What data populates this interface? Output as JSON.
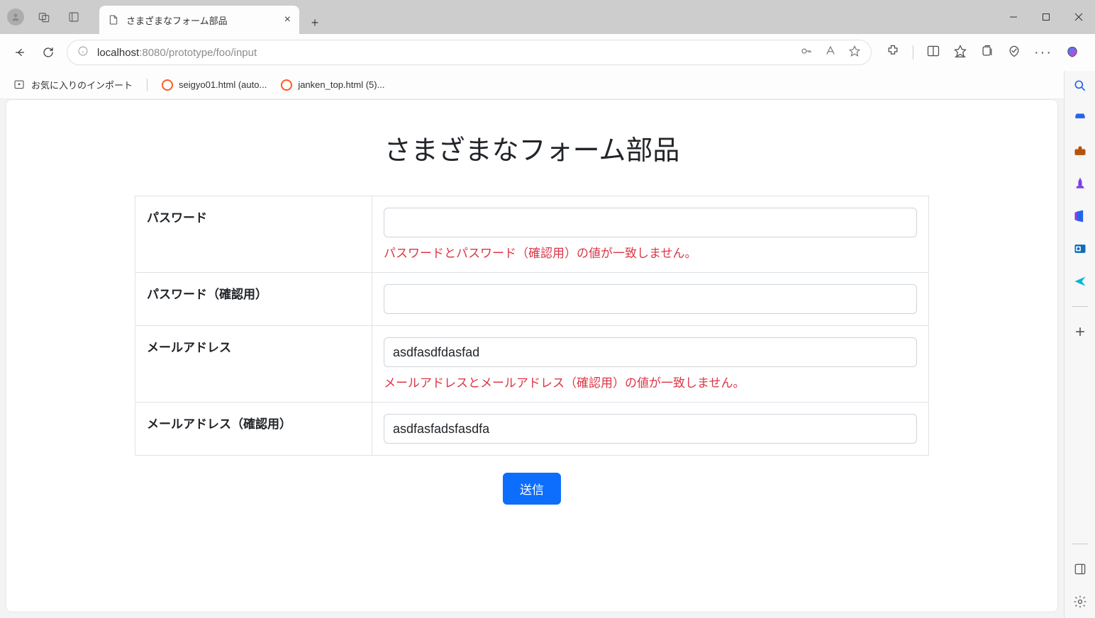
{
  "window": {
    "tab_title": "さまざまなフォーム部品"
  },
  "addressbar": {
    "host": "localhost",
    "port_path": ":8080/prototype/foo/input"
  },
  "bookmarks": {
    "import_label": "お気に入りのインポート",
    "items": [
      {
        "label": "seigyo01.html (auto..."
      },
      {
        "label": "janken_top.html (5)..."
      }
    ]
  },
  "page": {
    "title": "さまざまなフォーム部品",
    "rows": [
      {
        "label": "パスワード",
        "value": "",
        "error": "パスワードとパスワード（確認用）の値が一致しません。"
      },
      {
        "label": "パスワード（確認用）",
        "value": "",
        "error": ""
      },
      {
        "label": "メールアドレス",
        "value": "asdfasdfdasfad",
        "error": "メールアドレスとメールアドレス（確認用）の値が一致しません。"
      },
      {
        "label": "メールアドレス（確認用）",
        "value": "asdfasfadsfasdfa",
        "error": ""
      }
    ],
    "submit_label": "送信"
  }
}
